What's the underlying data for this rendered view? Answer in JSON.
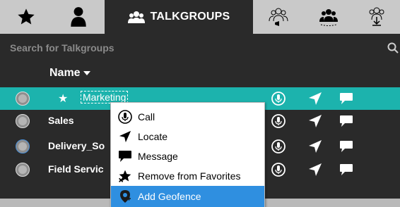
{
  "tabs": [
    {
      "id": "favorites",
      "icon": "star-icon"
    },
    {
      "id": "contacts",
      "icon": "person-icon"
    },
    {
      "id": "talkgroups",
      "icon": "group-icon",
      "label": "TALKGROUPS",
      "active": true
    },
    {
      "id": "broadcast",
      "icon": "broadcast-group-icon"
    },
    {
      "id": "dynamic",
      "icon": "dynamic-group-icon"
    },
    {
      "id": "import",
      "icon": "download-group-icon"
    }
  ],
  "search": {
    "placeholder": "Search for Talkgroups"
  },
  "list_header": {
    "name_label": "Name"
  },
  "rows": [
    {
      "name": "Marketing",
      "favorite": true,
      "selected": true
    },
    {
      "name": "Sales"
    },
    {
      "name": "Delivery_So"
    },
    {
      "name": "Field Servic"
    }
  ],
  "context_menu": {
    "items": [
      {
        "label": "Call",
        "icon": "mic-icon"
      },
      {
        "label": "Locate",
        "icon": "locate-arrow-icon"
      },
      {
        "label": "Message",
        "icon": "message-bubble-icon"
      },
      {
        "label": "Remove from Favorites",
        "icon": "remove-star-icon"
      },
      {
        "label": "Add Geofence",
        "icon": "geofence-icon",
        "highlighted": true
      }
    ]
  },
  "colors": {
    "selected_row": "#1cb3ad",
    "menu_highlight": "#2f8fe0",
    "tabbar": "#c9c9c9",
    "background": "#2a2a2a"
  }
}
